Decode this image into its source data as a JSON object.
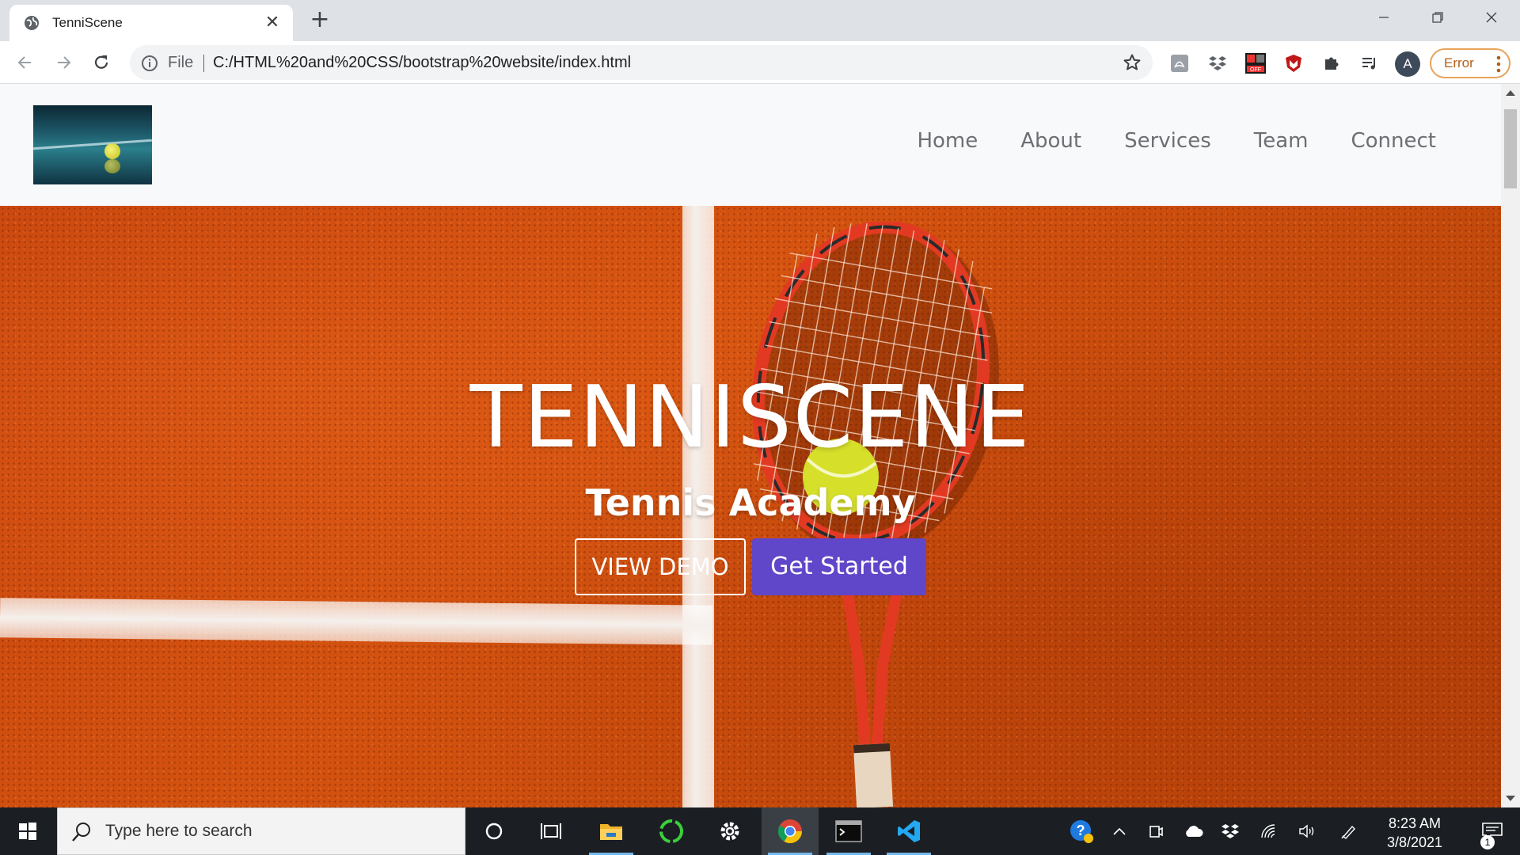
{
  "browser": {
    "tab_title": "TenniScene",
    "tab_close": "✕",
    "new_tab": "+",
    "file_label": "File",
    "url": "C:/HTML%20and%20CSS/bootstrap%20website/index.html",
    "avatar_letter": "A",
    "error_label": "Error",
    "extensions": [
      "pdf-icon",
      "dropbox-icon",
      "ad-off-icon",
      "mcafee-icon",
      "puzzle-icon",
      "media-queue-icon"
    ]
  },
  "site": {
    "nav": {
      "items": [
        {
          "label": "Home"
        },
        {
          "label": "About"
        },
        {
          "label": "Services"
        },
        {
          "label": "Team"
        },
        {
          "label": "Connect"
        }
      ]
    },
    "hero": {
      "title": "TENNISCENE",
      "subtitle": "Tennis Academy",
      "demo_button": "VIEW DEMO",
      "start_button": "Get Started"
    },
    "colors": {
      "accent": "#6046c8",
      "clay": "#c8460e",
      "nav_text": "#6c6f73"
    }
  },
  "taskbar": {
    "search_placeholder": "Type here to search",
    "time": "8:23 AM",
    "date": "3/8/2021",
    "notification_count": "1",
    "apps": [
      "cortana-icon",
      "task-view-icon",
      "file-explorer-icon",
      "sync-icon",
      "settings-icon",
      "chrome-icon",
      "terminal-icon",
      "vscode-icon"
    ]
  }
}
